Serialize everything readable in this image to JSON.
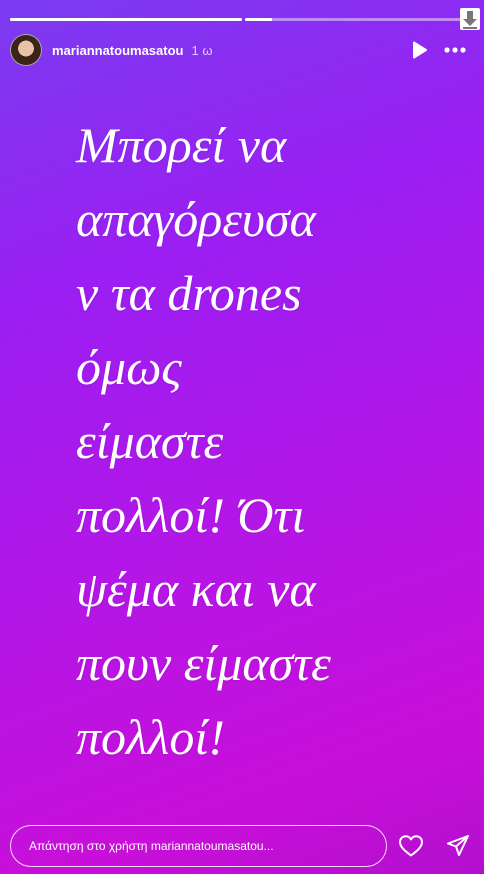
{
  "story": {
    "background_colors": [
      "#7a3cf0",
      "#b416e6",
      "#c80fd9"
    ],
    "progress": [
      {
        "segment": 1,
        "filled": 1.0
      },
      {
        "segment": 2,
        "filled": 0.12
      }
    ]
  },
  "header": {
    "username": "mariannatoumasatou",
    "time": "1 ω",
    "play_icon": "play-icon",
    "more_icon": "more-icon"
  },
  "content": {
    "text": "Μπορεί να\nαπαγόρευσα\nν  τα drones\nόμως\nείμαστε\nπολλοί! Ότι\nψέμα και να\nπουν είμαστε\nπολλοί!"
  },
  "footer": {
    "reply_placeholder": "Απάντηση στο χρήστη mariannatoumasatou...",
    "like_icon": "heart-icon",
    "share_icon": "send-icon"
  }
}
